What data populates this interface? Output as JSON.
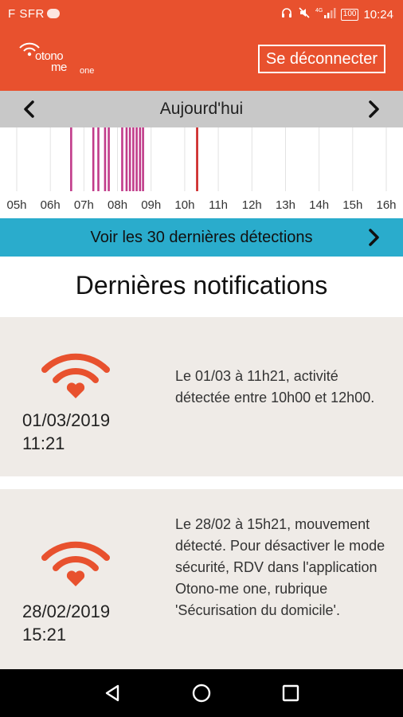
{
  "status_bar": {
    "carrier": "F SFR",
    "network": "4G",
    "battery": "100",
    "time": "10:24"
  },
  "header": {
    "logo": {
      "line1": "otono",
      "line2": "me",
      "line3": "one"
    },
    "logout_label": "Se déconnecter"
  },
  "day_nav": {
    "title": "Aujourd'hui",
    "prev_icon": "chevron-left-icon",
    "next_icon": "chevron-right-icon"
  },
  "timeline": {
    "hour_labels": [
      "05h",
      "06h",
      "07h",
      "08h",
      "09h",
      "10h",
      "11h",
      "12h",
      "13h",
      "14h",
      "15h",
      "16h"
    ],
    "events": [
      {
        "time": 6.62,
        "color": "#c13c8a"
      },
      {
        "time": 7.28,
        "color": "#c13c8a"
      },
      {
        "time": 7.43,
        "color": "#c13c8a"
      },
      {
        "time": 7.63,
        "color": "#c13c8a"
      },
      {
        "time": 7.74,
        "color": "#c13c8a"
      },
      {
        "time": 8.14,
        "color": "#c13c8a"
      },
      {
        "time": 8.27,
        "color": "#c13c8a"
      },
      {
        "time": 8.37,
        "color": "#c13c8a"
      },
      {
        "time": 8.47,
        "color": "#c13c8a"
      },
      {
        "time": 8.57,
        "color": "#c13c8a"
      },
      {
        "time": 8.67,
        "color": "#c13c8a"
      },
      {
        "time": 8.76,
        "color": "#c13c8a"
      },
      {
        "time": 10.37,
        "color": "#cc2222"
      }
    ],
    "range": [
      5,
      16
    ]
  },
  "detections": {
    "label": "Voir les 30 dernières détections",
    "arrow_icon": "chevron-right-icon"
  },
  "section_title": "Dernières notifications",
  "notifications": [
    {
      "icon": "wifi-heart-icon",
      "date": "01/03/2019",
      "time": "11:21",
      "message": "Le 01/03 à 11h21, activité détectée entre 10h00 et 12h00."
    },
    {
      "icon": "wifi-heart-icon",
      "date": "28/02/2019",
      "time": "15:21",
      "message": "Le 28/02 à 15h21, mouvement détecté. Pour désactiver le mode sécurité, RDV dans l'application Otono-me one, rubrique 'Sécurisation du domicile'."
    }
  ],
  "colors": {
    "brand": "#e8512e",
    "accent": "#2aaccc",
    "card_bg": "#efebe7",
    "event_pink": "#c13c8a",
    "event_red": "#cc2222"
  },
  "nav_bar": {
    "back_icon": "back-triangle-icon",
    "home_icon": "home-circle-icon",
    "recents_icon": "recents-square-icon"
  }
}
